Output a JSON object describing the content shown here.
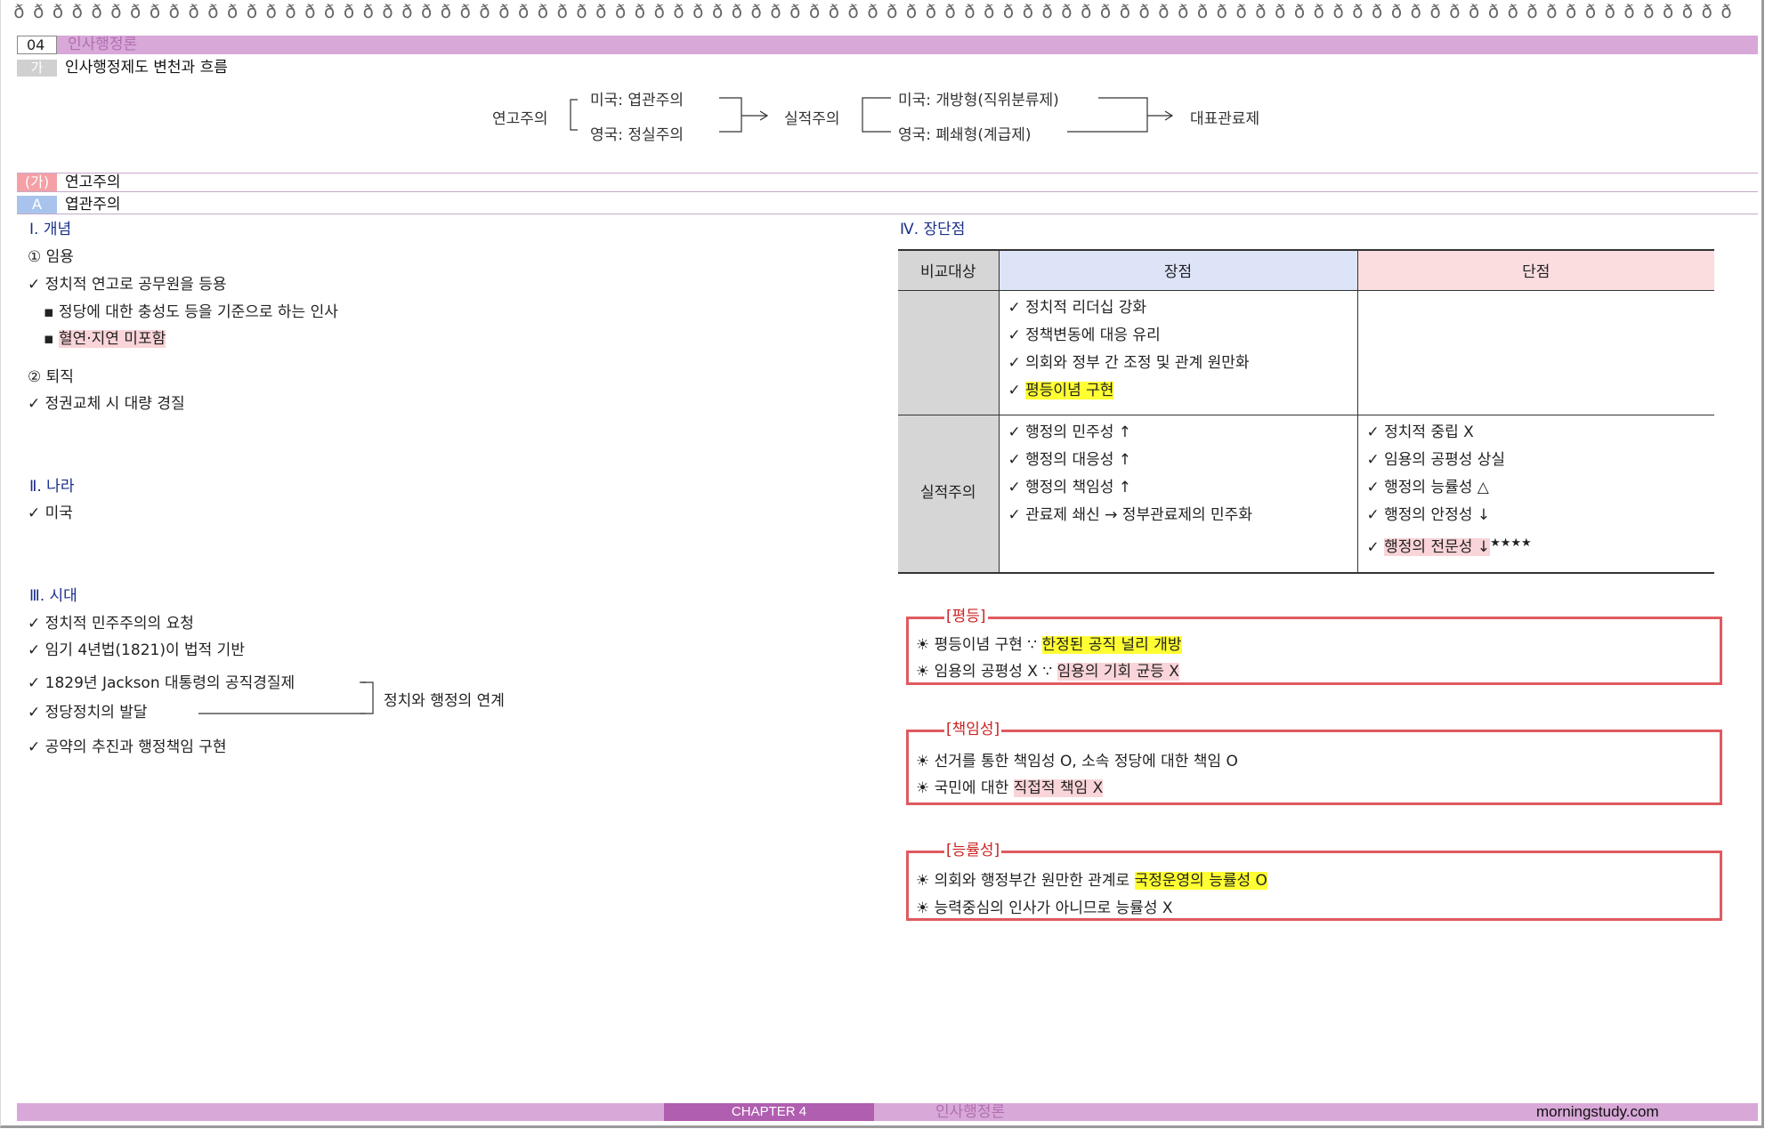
{
  "header": {
    "chapter_num": "04",
    "chapter_title": "인사행정론"
  },
  "section_ga": {
    "tag": "가",
    "title": "인사행정제도 변천과 흐름"
  },
  "flow": {
    "root": "연고주의",
    "us_patronage": "미국: 엽관주의",
    "uk_patronage": "영국: 정실주의",
    "merit": "실적주의",
    "us_open": "미국: 개방형(직위분류제)",
    "uk_closed": "영국: 폐쇄형(계급제)",
    "representative": "대표관료제"
  },
  "section_ka": {
    "tag": "(가)",
    "title": "연고주의"
  },
  "section_a": {
    "tag": "A",
    "title": "엽관주의"
  },
  "left": {
    "concept_h": "Ⅰ. 개념",
    "appoint_h": "① 임용",
    "appoint_1": "✓ 정치적 연고로 공무원을 등용",
    "appoint_2": "▪ 정당에 대한 충성도 등을 기준으로 하는 인사",
    "appoint_3_prefix": "▪ ",
    "appoint_3": "혈연·지연 미포함",
    "retire_h": "② 퇴직",
    "retire_1": "✓ 정권교체 시 대량 경질",
    "country_h": "Ⅱ. 나라",
    "country_1": "✓ 미국",
    "era_h": "Ⅲ. 시대",
    "era_1": "✓ 정치적 민주주의의 요청",
    "era_2": "✓ 임기 4년법(1821)이 법적 기반",
    "era_3": "✓ 1829년 Jackson 대통령의 공직경질제",
    "era_4": "✓ 정당정치의 발달",
    "era_link": "정치와 행정의 연계",
    "era_5": "✓ 공약의 추진과 행정책임 구현"
  },
  "pros_cons": {
    "heading": "Ⅳ. 장단점",
    "col_subject": "비교대상",
    "col_pros": "장점",
    "col_cons": "단점",
    "row1_label": "",
    "row1_pros": [
      "✓ 정치적 리더십 강화",
      "✓ 정책변동에 대응 유리",
      "✓ 의회와 정부 간 조정 및 관계 원만화"
    ],
    "row1_pros_last_prefix": "✓ ",
    "row1_pros_last": "평등이념 구현",
    "row2_label": "실적주의",
    "row2_pros": [
      "✓ 행정의 민주성 ↑",
      "✓ 행정의 대응성 ↑",
      "✓ 행정의 책임성 ↑",
      "✓ 관료제 쇄신 → 정부관료제의 민주화"
    ],
    "row2_cons": [
      "✓ 정치적 중립 X",
      "✓ 임용의 공평성 상실",
      "✓ 행정의 능률성 △",
      "✓ 행정의 안정성 ↓"
    ],
    "row2_cons_last_prefix": "✓ ",
    "row2_cons_last": "행정의 전문성 ↓",
    "row2_cons_stars": "★★★★"
  },
  "boxes": {
    "equality": {
      "title": "[평등]",
      "l1_a": "☀ 평등이념 구현 ∵ ",
      "l1_b": "한정된 공직 널리 개방",
      "l2_a": "☀ 임용의 공평성 X  ∵ ",
      "l2_b": "임용의 기회 균등 X"
    },
    "responsibility": {
      "title": "[책임성]",
      "l1": "☀ 선거를 통한 책임성 O, 소속 정당에 대한 책임 O",
      "l2_a": "☀ 국민에 대한 ",
      "l2_b": "직접적 책임 X"
    },
    "efficiency": {
      "title": "[능률성]",
      "l1_a": "☀ 의회와 행정부간 원만한 관계로 ",
      "l1_b": "국정운영의 능률성 O",
      "l2": "☀ 능력중심의 인사가 아니므로 능률성 X"
    }
  },
  "footer": {
    "chapter": "CHAPTER 4",
    "title": "인사행정론",
    "site": "morningstudy.com"
  }
}
